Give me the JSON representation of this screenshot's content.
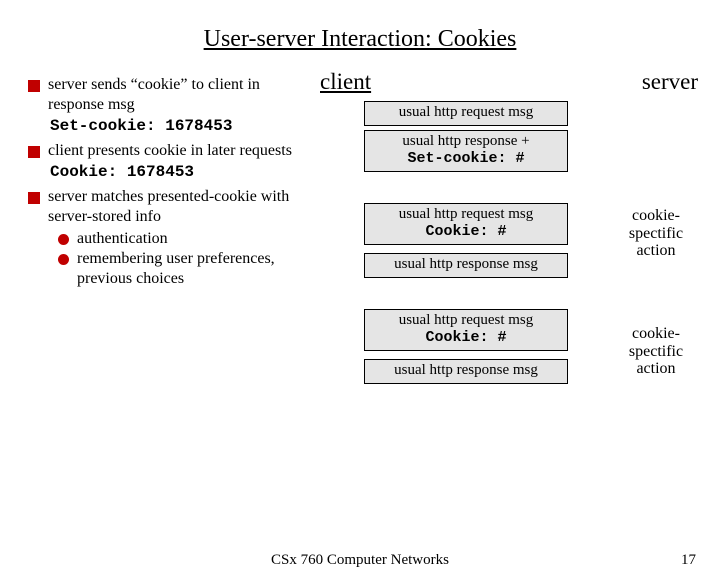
{
  "title": "User-server Interaction: Cookies",
  "bullets": {
    "b1": "server sends “cookie” to client in response msg",
    "b1code": "Set-cookie: 1678453",
    "b2": "client presents cookie in later requests",
    "b2code": "Cookie: 1678453",
    "b3": "server matches presented-cookie with server-stored info",
    "b3sub1": "authentication",
    "b3sub2": "remembering user preferences, previous choices"
  },
  "heading_client": "client",
  "heading_server": "server",
  "messages": {
    "m1": "usual http request msg",
    "m2a": "usual http response +",
    "m2b": "Set-cookie: #",
    "m3a": "usual http request msg",
    "m3b": "Cookie: #",
    "m4": "usual http response msg",
    "m5a": "usual http request msg",
    "m5b": "Cookie: #",
    "m6": "usual http response msg"
  },
  "annot1": "cookie-spectific action",
  "annot2": "cookie-spectific action",
  "footer_center": "CSx 760 Computer Networks",
  "footer_right": "17"
}
